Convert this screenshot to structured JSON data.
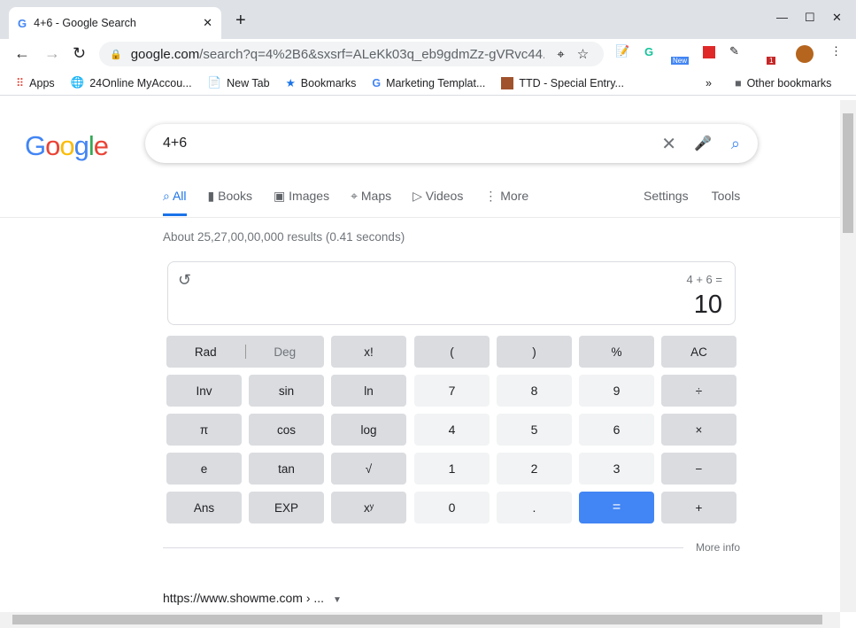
{
  "browser": {
    "tab_title": "4+6 - Google Search",
    "url_host": "google.com",
    "url_path": "/search?q=4%2B6&sxsrf=ALeKk03q_eb9gdmZz-gVRvc44...",
    "ext_badge_new": "New",
    "ext_badge_count": "1",
    "bookmarks": [
      "Apps",
      "24Online MyAccou...",
      "New Tab",
      "Bookmarks",
      "Marketing Templat...",
      "TTD - Special Entry..."
    ],
    "other_bookmarks": "Other bookmarks"
  },
  "search": {
    "logo": "Google",
    "query": "4+6",
    "tabs": [
      "All",
      "Books",
      "Images",
      "Maps",
      "Videos",
      "More"
    ],
    "settings": "Settings",
    "tools": "Tools",
    "stats": "About 25,27,00,00,000 results (0.41 seconds)"
  },
  "calculator": {
    "expression": "4 + 6 =",
    "result": "10",
    "rad": "Rad",
    "deg": "Deg",
    "buttons": [
      [
        "x!",
        "(",
        ")",
        "%",
        "AC"
      ],
      [
        "Inv",
        "sin",
        "ln",
        "7",
        "8",
        "9",
        "÷"
      ],
      [
        "π",
        "cos",
        "log",
        "4",
        "5",
        "6",
        "×"
      ],
      [
        "e",
        "tan",
        "√",
        "1",
        "2",
        "3",
        "−"
      ],
      [
        "Ans",
        "EXP",
        "xʸ",
        "0",
        ".",
        "=",
        "+"
      ]
    ],
    "more_info": "More info"
  },
  "result_cite": "https://www.showme.com › ...",
  "colors": {
    "accent": "#1a73e8",
    "equals": "#4285f4"
  }
}
